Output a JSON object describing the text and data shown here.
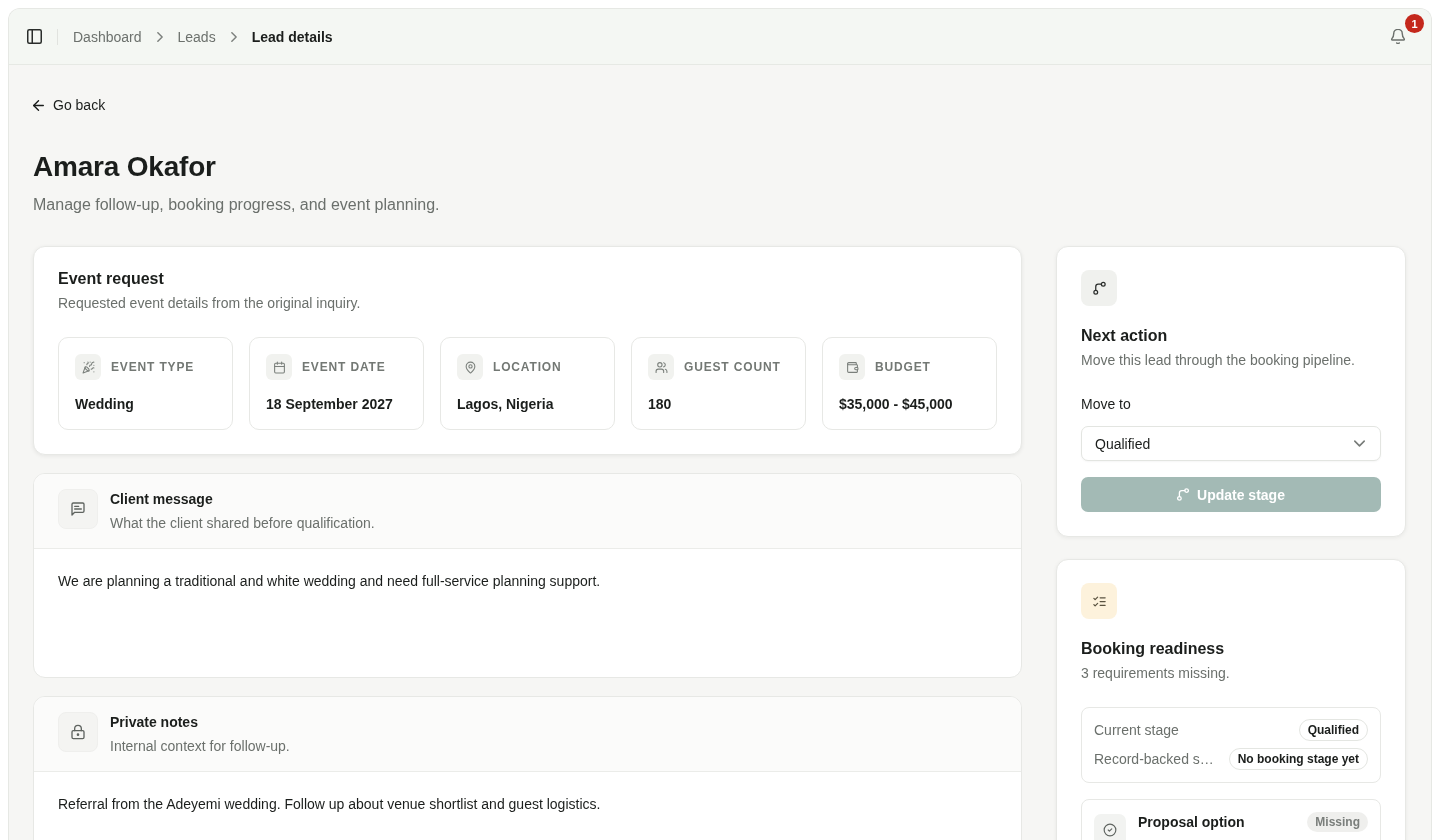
{
  "header": {
    "breadcrumbs": [
      {
        "label": "Dashboard",
        "current": false
      },
      {
        "label": "Leads",
        "current": false
      },
      {
        "label": "Lead details",
        "current": true
      }
    ],
    "notifications": {
      "count": "1"
    }
  },
  "back_link": {
    "label": "Go back"
  },
  "page": {
    "title": "Amara Okafor",
    "subtitle": "Manage follow-up, booking progress, and event planning."
  },
  "event_request": {
    "title": "Event request",
    "subtitle": "Requested event details from the original inquiry.",
    "fields": [
      {
        "kind": "event_type",
        "label": "EVENT TYPE",
        "value": "Wedding"
      },
      {
        "kind": "date",
        "label": "EVENT DATE",
        "value": "18 September 2027"
      },
      {
        "kind": "location",
        "label": "LOCATION",
        "value": "Lagos, Nigeria"
      },
      {
        "kind": "guests",
        "label": "GUEST COUNT",
        "value": "180"
      },
      {
        "kind": "budget",
        "label": "BUDGET",
        "value": "$35,000 - $45,000"
      }
    ]
  },
  "sections": [
    {
      "kind": "message",
      "title": "Client message",
      "subtitle": "What the client shared before qualification.",
      "body": "We are planning a traditional and white wedding and need full-service planning support."
    },
    {
      "kind": "notes",
      "title": "Private notes",
      "subtitle": "Internal context for follow-up.",
      "body": "Referral from the Adeyemi wedding. Follow up about venue shortlist and guest logistics."
    }
  ],
  "next_action": {
    "title": "Next action",
    "subtitle": "Move this lead through the booking pipeline.",
    "field_label": "Move to",
    "select": {
      "value": "Qualified"
    },
    "button": {
      "label": "Update stage",
      "disabled": true
    }
  },
  "booking_readiness": {
    "title": "Booking readiness",
    "subtitle": "3 requirements missing.",
    "stages": [
      {
        "label": "Current stage",
        "value": "Qualified"
      },
      {
        "label": "Record-backed s…",
        "value": "No booking stage yet"
      }
    ],
    "requirements": [
      {
        "title": "Proposal option",
        "status": "Missing",
        "met": false
      }
    ]
  }
}
